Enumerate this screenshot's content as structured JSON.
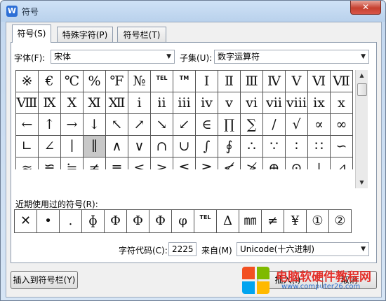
{
  "window": {
    "title": "符号",
    "app_icon": "W",
    "close_label": "✕"
  },
  "tabs": [
    {
      "label": "符号(S)",
      "active": true
    },
    {
      "label": "特殊字符(P)",
      "active": false
    },
    {
      "label": "符号栏(T)",
      "active": false
    }
  ],
  "font": {
    "label": "字体(F):",
    "value": "宋体"
  },
  "subset": {
    "label": "子集(U):",
    "value": "数字运算符"
  },
  "grid": {
    "rows": [
      [
        "※",
        "€",
        "℃",
        "%",
        "℉",
        "№",
        "TEL",
        "TM",
        "Ⅰ",
        "Ⅱ",
        "Ⅲ",
        "Ⅳ",
        "Ⅴ",
        "Ⅵ",
        "Ⅶ"
      ],
      [
        "Ⅷ",
        "Ⅸ",
        "Ⅹ",
        "Ⅺ",
        "Ⅻ",
        "ⅰ",
        "ⅱ",
        "ⅲ",
        "ⅳ",
        "ⅴ",
        "ⅵ",
        "ⅶ",
        "ⅷ",
        "ⅸ",
        "ⅹ"
      ],
      [
        "←",
        "↑",
        "→",
        "↓",
        "↖",
        "↗",
        "↘",
        "↙",
        "∈",
        "∏",
        "∑",
        "∕",
        "√",
        "∝",
        "∞"
      ],
      [
        "∟",
        "∠",
        "∣",
        "∥",
        "∧",
        "∨",
        "∩",
        "∪",
        "∫",
        "∮",
        "∴",
        "∵",
        "∶",
        "∷",
        "∽"
      ],
      [
        "≈",
        "≌",
        "≒",
        "≠",
        "≡",
        "≤",
        "≥",
        "≦",
        "≧",
        "≮",
        "≯",
        "⊕",
        "⊙",
        "⊥",
        "⊿"
      ]
    ],
    "selected": {
      "row": 3,
      "col": 3
    }
  },
  "recent": {
    "label": "近期使用过的符号(R):",
    "items": [
      "✕",
      "•",
      ".",
      "ɸ",
      "Φ",
      "Φ",
      "Φ",
      "φ",
      "TEL",
      "Δ",
      "㎜",
      "≠",
      "¥",
      "①",
      "②"
    ]
  },
  "char_code": {
    "label": "字符代码(C):",
    "value": "2225"
  },
  "from": {
    "label": "来自(M)",
    "value": "Unicode(十六进制)"
  },
  "buttons": {
    "insert_to_bar": "插入到符号栏(Y)",
    "insert": "插入(I)",
    "cancel": "取消"
  },
  "watermark": {
    "title": "电脑软硬件教程网",
    "url": "www.computer26.com"
  }
}
